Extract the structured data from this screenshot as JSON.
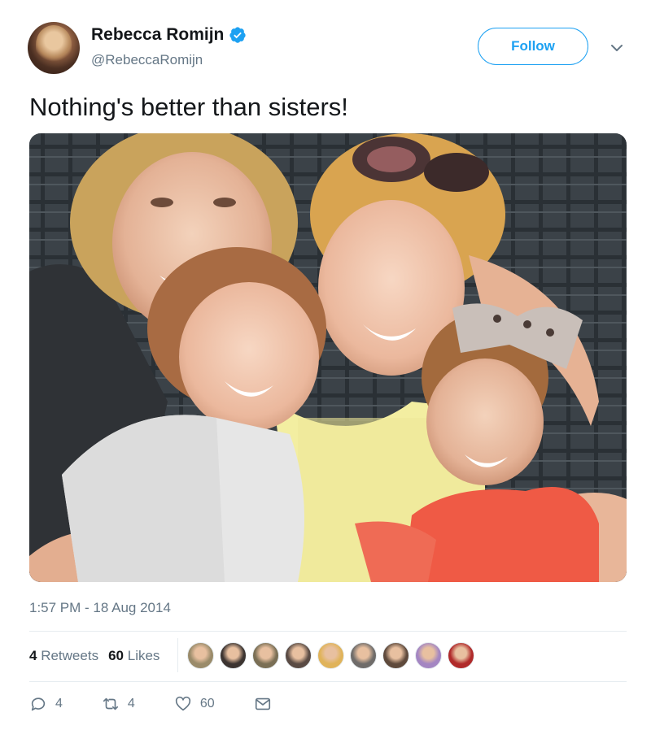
{
  "author": {
    "name": "Rebecca Romijn",
    "handle": "@RebeccaRomijn",
    "verified": true
  },
  "follow_label": "Follow",
  "tweet": {
    "text": "Nothing's better than sisters!",
    "timestamp": "1:57 PM - 18 Aug 2014"
  },
  "stats": {
    "retweets_count": "4",
    "retweets_label": "Retweets",
    "likes_count": "60",
    "likes_label": "Likes"
  },
  "actions": {
    "reply_count": "4",
    "retweet_count": "4",
    "like_count": "60"
  },
  "likers": [
    {
      "color": "#9a8b6a"
    },
    {
      "color": "#3c3431"
    },
    {
      "color": "#7a6f55"
    },
    {
      "color": "#5a4b44"
    },
    {
      "color": "#e0b35a"
    },
    {
      "color": "#6f6c6a"
    },
    {
      "color": "#5f4a3c"
    },
    {
      "color": "#a486c2"
    },
    {
      "color": "#b02a2a"
    }
  ],
  "colors": {
    "accent": "#1da1f2",
    "secondary_text": "#657786",
    "divider": "#e6ecf0"
  },
  "icons": [
    "verified-badge-icon",
    "chevron-down-icon",
    "reply-icon",
    "retweet-icon",
    "heart-icon",
    "direct-message-icon"
  ]
}
